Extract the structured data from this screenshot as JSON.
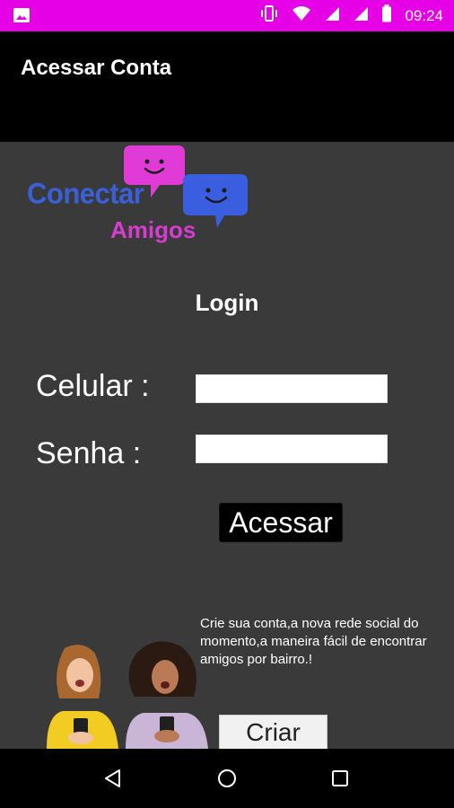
{
  "status_bar": {
    "time": "09:24",
    "background": "#e600e6",
    "icons": [
      "image-icon",
      "vibrate-icon",
      "wifi-icon",
      "signal-icon",
      "signal-icon-2",
      "battery-icon"
    ]
  },
  "app_bar": {
    "title": "Acessar Conta",
    "background": "#000000"
  },
  "logo": {
    "word1": "Conectar",
    "word2": "Amigos",
    "word1_color": "#3b5fd6",
    "word2_color": "#d53ccf"
  },
  "login": {
    "title": "Login",
    "phone_label": "Celular :",
    "phone_value": "",
    "password_label": "Senha :",
    "password_value": "",
    "submit_label": "Acessar"
  },
  "promo": {
    "text": "Crie sua conta,a nova rede social do momento,a maneira fácil de encontrar amigos por bairro.!",
    "create_label": "Criar"
  },
  "nav_bar": {
    "buttons": [
      "back-icon",
      "home-icon",
      "recents-icon"
    ]
  }
}
